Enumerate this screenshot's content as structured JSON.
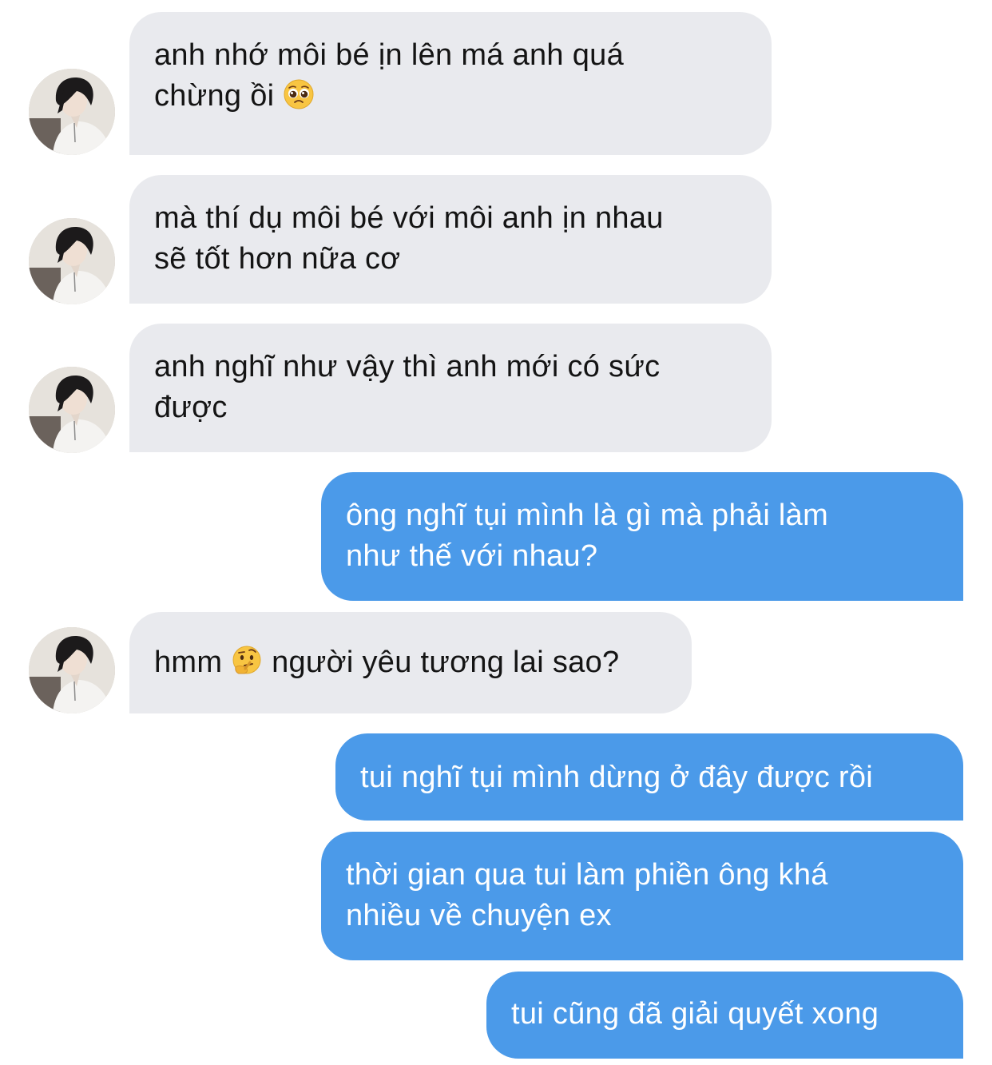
{
  "conversation": {
    "messages": [
      {
        "sender": "other",
        "text": "anh nhớ môi bé ịn lên má anh quá chừng ồi",
        "emoji": "pleading-face-emoji"
      },
      {
        "sender": "other",
        "text": "mà thí dụ môi bé với môi anh ịn nhau sẽ tốt hơn nữa cơ"
      },
      {
        "sender": "other",
        "text": "anh nghĩ như vậy thì anh mới có sức được"
      },
      {
        "sender": "me",
        "text": "ông nghĩ tụi mình là gì mà phải làm như thế với nhau?"
      },
      {
        "sender": "other",
        "text_before": "hmm",
        "emoji": "thinking-face-emoji",
        "text_after": "người yêu tương lai sao?"
      },
      {
        "sender": "me",
        "text": "tui nghĩ tụi mình dừng ở đây được rồi"
      },
      {
        "sender": "me",
        "text": "thời gian qua tui làm phiền ông khá nhiều về chuyện ex"
      },
      {
        "sender": "me",
        "text": "tui cũng đã giải quyết xong"
      }
    ],
    "m1": {
      "line1": "anh nhớ môi bé ịn lên má anh quá",
      "line2": "chừng ồi"
    },
    "m2": {
      "line1": "mà thí dụ môi bé với môi anh ịn nhau",
      "line2": "sẽ tốt hơn nữa cơ"
    },
    "m3": {
      "line1": "anh nghĩ như vậy thì anh mới có sức",
      "line2": "được"
    },
    "m4": {
      "line1": "ông nghĩ tụi mình là gì mà phải làm",
      "line2": "như thế với nhau?"
    },
    "m5": {
      "before": "hmm",
      "after": "người yêu tương lai sao?"
    },
    "m6": {
      "line1": "tui nghĩ tụi mình dừng ở đây được rồi"
    },
    "m7": {
      "line1": "thời gian qua tui làm phiền ông khá",
      "line2": "nhiều về chuyện ex"
    },
    "m8": {
      "line1": "tui cũng đã giải quyết xong"
    }
  },
  "colors": {
    "incoming_bubble": "#e9eaee",
    "outgoing_bubble": "#4b9ae9",
    "incoming_text": "#141414",
    "outgoing_text": "#ffffff"
  }
}
